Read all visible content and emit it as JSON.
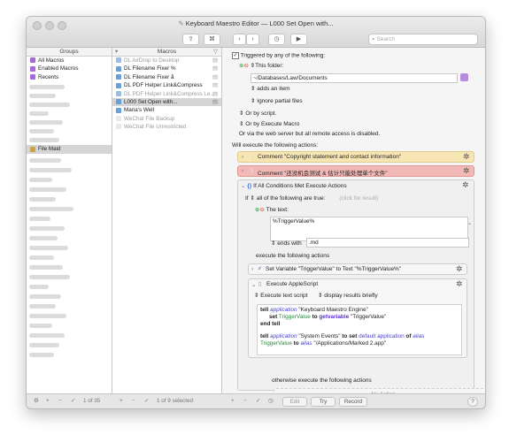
{
  "window": {
    "title": "Keyboard Maestro Editor — L000 Set Open with..."
  },
  "toolbar": {
    "search_placeholder": "Search"
  },
  "groups": {
    "header": "Groups",
    "items": [
      "All Macros",
      "Enabled Macros",
      "Recents",
      "File Maid"
    ],
    "count": "1 of 35"
  },
  "macros": {
    "header": "Macros",
    "items": [
      "DL AirDrop to Desktop",
      "DL Filename Fixer %",
      "DL Filename Fixer å",
      "DL PDF Helper Link&Compress",
      "DL PDF Helper Link&Compress Le...",
      "L000 Set Open with...",
      "Maria's Well",
      "WeChat File Backup",
      "WeChat File Unrestricted"
    ],
    "count": "1 of 9 selected"
  },
  "editor": {
    "triggered_by": "Triggered by any of the following:",
    "this_folder": "This folder:",
    "folder_path": "~/Databases/Law/Documents",
    "adds_an_item": "adds an item",
    "ignore_partial": "Ignore partial files",
    "or_by_script": "Or by script.",
    "or_by_execute_macro": "Or by Execute Macro",
    "web_server_note": "Or via the web server but all remote access is disabled.",
    "will_execute": "Will execute the following actions:",
    "comment1": "Comment \"Copyright statement and contact information\"",
    "comment2": "Comment \"还没机会测试 & 估计只能处理单个文件\"",
    "if_all": "If All Conditions Met Execute Actions",
    "if_prefix": "If",
    "all_conditions_true": "all of the following are true:",
    "click_for_result": "(click for result)",
    "the_text": "The text:",
    "text_value": "%TriggerValue%",
    "ends_with": "ends with",
    "ends_value": ".md",
    "execute_following": "execute the following actions",
    "set_variable": "Set Variable \"TriggerValue\" to Text \"%TriggerValue%\"",
    "execute_applescript": "Execute AppleScript",
    "execute_text_script": "Execute text script",
    "display_results": "display results briefly",
    "otherwise": "otherwise execute the following actions",
    "no_action": "No Action"
  },
  "code": {
    "l1_tell": "tell",
    "l1_app": "application",
    "l1_name": "\"Keyboard Maestro Engine\"",
    "l2_set": "set",
    "l2_var": "TriggerValue",
    "l2_to": "to",
    "l2_getvar": "getvariable",
    "l2_str": "\"TriggerValue\"",
    "l3_end": "end tell",
    "l4_tell": "tell",
    "l4_app": "application",
    "l4_name": "\"System Events\"",
    "l4_to": "to",
    "l4_set": "set",
    "l4_default": "default application",
    "l4_of": "of",
    "l4_alias": "alias",
    "l5_var": "TriggerValue",
    "l5_to": "to",
    "l5_alias": "alias",
    "l5_str": "\"/Applications/Marked 2.app\""
  },
  "bottom": {
    "edit": "Edit",
    "try": "Try",
    "record": "Record",
    "help": "?"
  },
  "colors": {
    "comment_yellow": "#f7e6b4",
    "comment_red": "#f2b9b6",
    "accent_blue": "#3b6fd6",
    "selection": "#d5d5d5"
  }
}
